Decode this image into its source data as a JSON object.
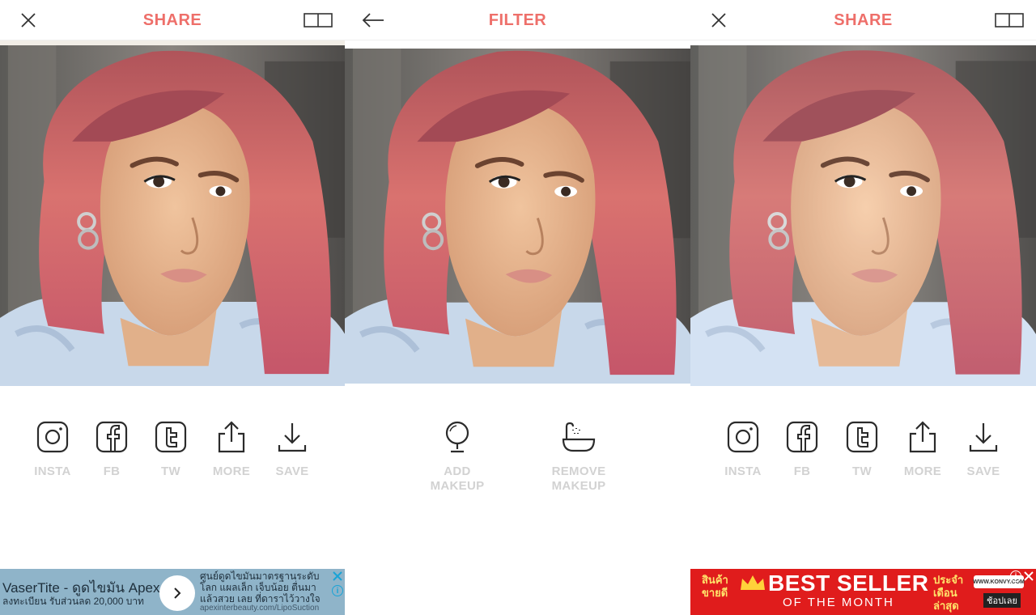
{
  "panels": [
    {
      "title": "SHARE",
      "left_icon": "close-icon",
      "right_icon": "compare-icon",
      "actions": [
        {
          "label": "INSTA",
          "icon": "instagram-icon"
        },
        {
          "label": "FB",
          "icon": "facebook-icon"
        },
        {
          "label": "TW",
          "icon": "twitter-icon"
        },
        {
          "label": "MORE",
          "icon": "share-upload-icon"
        },
        {
          "label": "SAVE",
          "icon": "download-icon"
        }
      ],
      "ad": {
        "title": "VaserTite - ดูดไขมัน Apex",
        "subtitle": "ลงทะเบียน รับส่วนลด 20,000 บาท",
        "description": "ศูนย์ดูดไขมันมาตรฐานระดับ โลก แผลเล็ก เจ็บน้อย ตื่นมาแล้วสวย เลย ที่ดาราไว้วางใจ",
        "url": "apexinterbeauty.com/LipoSuction"
      }
    },
    {
      "title": "FILTER",
      "left_icon": "back-arrow-icon",
      "actions": [
        {
          "label_line1": "ADD",
          "label_line2": "MAKEUP",
          "icon": "mirror-icon"
        },
        {
          "label_line1": "REMOVE",
          "label_line2": "MAKEUP",
          "icon": "bathtub-icon"
        }
      ]
    },
    {
      "title": "SHARE",
      "left_icon": "close-icon",
      "right_icon": "compare-icon",
      "actions": [
        {
          "label": "INSTA",
          "icon": "instagram-icon"
        },
        {
          "label": "FB",
          "icon": "facebook-icon"
        },
        {
          "label": "TW",
          "icon": "twitter-icon"
        },
        {
          "label": "MORE",
          "icon": "share-upload-icon"
        },
        {
          "label": "SAVE",
          "icon": "download-icon"
        }
      ],
      "ad": {
        "promo_left": "สินค้า ขายดี",
        "headline": "BEST SELLER",
        "subline": "OF THE MONTH",
        "promo_right": "ประจำเดือน ล่าสุด",
        "brand": "WWW.KONVY.COM",
        "cta": "ช้อปเลย"
      }
    }
  ],
  "colors": {
    "accent": "#ee6f6a",
    "label_grey": "#d2d2d2",
    "icon_dark": "#2b2b2b",
    "ad1_bg": "#8fb4c9",
    "ad2_bg": "#e01c1c"
  }
}
